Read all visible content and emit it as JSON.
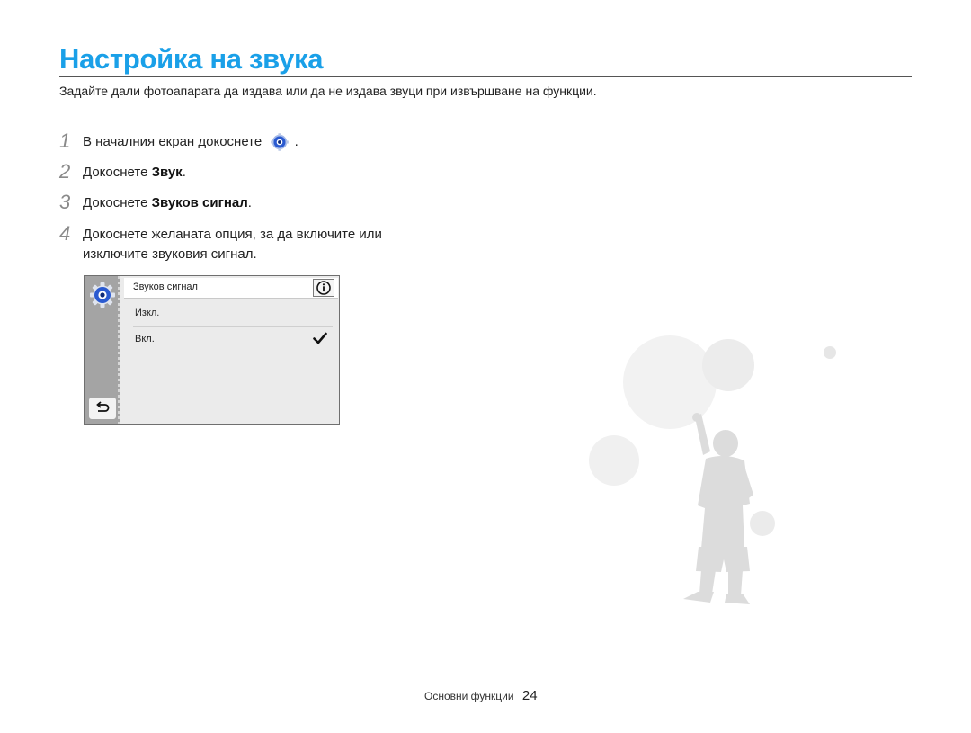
{
  "title": "Настройка на звука",
  "intro": "Задайте дали фотоапарата да издава или да не издава звуци при извършване на функции.",
  "steps": [
    {
      "num": "1",
      "text_before": "В началния екран докоснете",
      "icon": "settings-gear-icon",
      "text_after": "."
    },
    {
      "num": "2",
      "text_before": "Докоснете ",
      "bold": "Звук",
      "text_after": "."
    },
    {
      "num": "3",
      "text_before": "Докоснете ",
      "bold": "Звуков сигнал",
      "text_after": "."
    },
    {
      "num": "4",
      "line1": "Докоснете желаната опция, за да включите или",
      "line2": "изключите звуковия сигнал."
    }
  ],
  "screen": {
    "header": "Звуков сигнал",
    "options": [
      {
        "label": "Изкл.",
        "selected": false
      },
      {
        "label": "Вкл.",
        "selected": true
      }
    ],
    "icons": [
      "settings-gear-icon",
      "info-icon",
      "back-icon",
      "checkmark-icon"
    ]
  },
  "footer": {
    "section": "Основни функции",
    "page": "24"
  },
  "colors": {
    "title": "#1aa0e8",
    "step_number": "#8a8a8a",
    "gear_blue": "#1f4fc8"
  }
}
